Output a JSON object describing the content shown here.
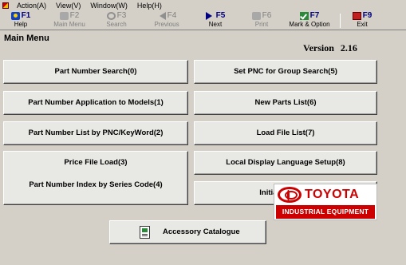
{
  "menubar": {
    "items": [
      {
        "label": "Action(A)"
      },
      {
        "label": "View(V)"
      },
      {
        "label": "Window(W)"
      },
      {
        "label": "Help(H)"
      }
    ]
  },
  "toolbar": {
    "buttons": [
      {
        "key": "F1",
        "label": "Help",
        "icon": "help-icon",
        "enabled": true
      },
      {
        "key": "F2",
        "label": "Main Menu",
        "icon": "main-menu-icon",
        "enabled": false
      },
      {
        "key": "F3",
        "label": "Search",
        "icon": "search-icon",
        "enabled": false
      },
      {
        "key": "F4",
        "label": "Previous",
        "icon": "previous-icon",
        "enabled": false
      },
      {
        "key": "F5",
        "label": "Next",
        "icon": "next-icon",
        "enabled": true
      },
      {
        "key": "F6",
        "label": "Print",
        "icon": "print-icon",
        "enabled": false
      },
      {
        "key": "F7",
        "label": "Mark & Option",
        "icon": "mark-option-icon",
        "enabled": true
      },
      {
        "key": "F9",
        "label": "Exit",
        "icon": "exit-icon",
        "enabled": true
      }
    ]
  },
  "main": {
    "title": "Main Menu",
    "version_label": "Version",
    "version_number": "2.16",
    "left_buttons": [
      {
        "label": "Part Number Search(0)"
      },
      {
        "label": "Part Number Application to Models(1)"
      },
      {
        "label": "Part Number List by PNC/KeyWord(2)"
      },
      {
        "label": "Price File Load(3)"
      },
      {
        "label": "Part Number Index by Series Code(4)"
      }
    ],
    "right_buttons": [
      {
        "label": "Set PNC for Group Search(5)"
      },
      {
        "label": "New Parts List(6)"
      },
      {
        "label": "Load File List(7)"
      },
      {
        "label": "Local Display Language Setup(8)"
      },
      {
        "label": "Initial Setup(9)"
      }
    ],
    "accessory_button": {
      "label": "Accessory Catalogue"
    }
  },
  "logo": {
    "brand": "TOYOTA",
    "subtitle": "INDUSTRIAL EQUIPMENT"
  },
  "colors": {
    "window_bg": "#d4d0c8",
    "button_face": "#e8e8e4",
    "function_key": "#000080",
    "brand_red": "#cc0000"
  }
}
